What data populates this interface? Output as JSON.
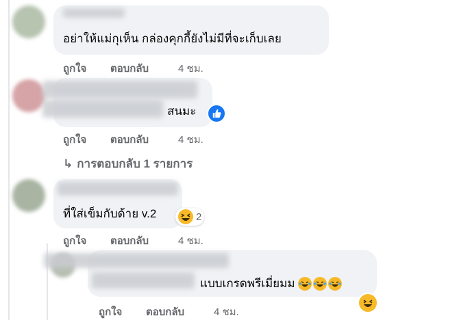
{
  "comments": [
    {
      "text": "อย่าให้แม่กุเห็น กล่องคุกกี้ยังไม่มีที่จะเก็บเลย",
      "actions": {
        "like": "ถูกใจ",
        "reply": "ตอบกลับ",
        "time": "4 ชม."
      }
    },
    {
      "text": "สนมะ",
      "reaction": "like-icon",
      "actions": {
        "like": "ถูกใจ",
        "reply": "ตอบกลับ",
        "time": "4 ชม."
      }
    },
    {
      "replies_label": "การตอบกลับ 1 รายการ"
    },
    {
      "text": "ที่ใส่เข็มกับด้าย v.2",
      "reaction": "laughing-face-icon",
      "reaction_count": "2",
      "actions": {
        "like": "ถูกใจ",
        "reply": "ตอบกลับ",
        "time": "4 ชม."
      }
    },
    {
      "text": "แบบเกรดพรีเมี่ยมม",
      "emojis": [
        "laughing-tears-icon",
        "laughing-tears-icon",
        "laughing-tears-icon"
      ],
      "reaction": "laughing-face-icon",
      "actions": {
        "like": "ถูกใจ",
        "reply": "ตอบกลับ",
        "time": "4 ชม."
      }
    }
  ],
  "colors": {
    "bubble": "#f0f2f5",
    "secondary_text": "#65676b",
    "like_blue": "#1877f2",
    "emoji_yellow": "#f7b928"
  }
}
